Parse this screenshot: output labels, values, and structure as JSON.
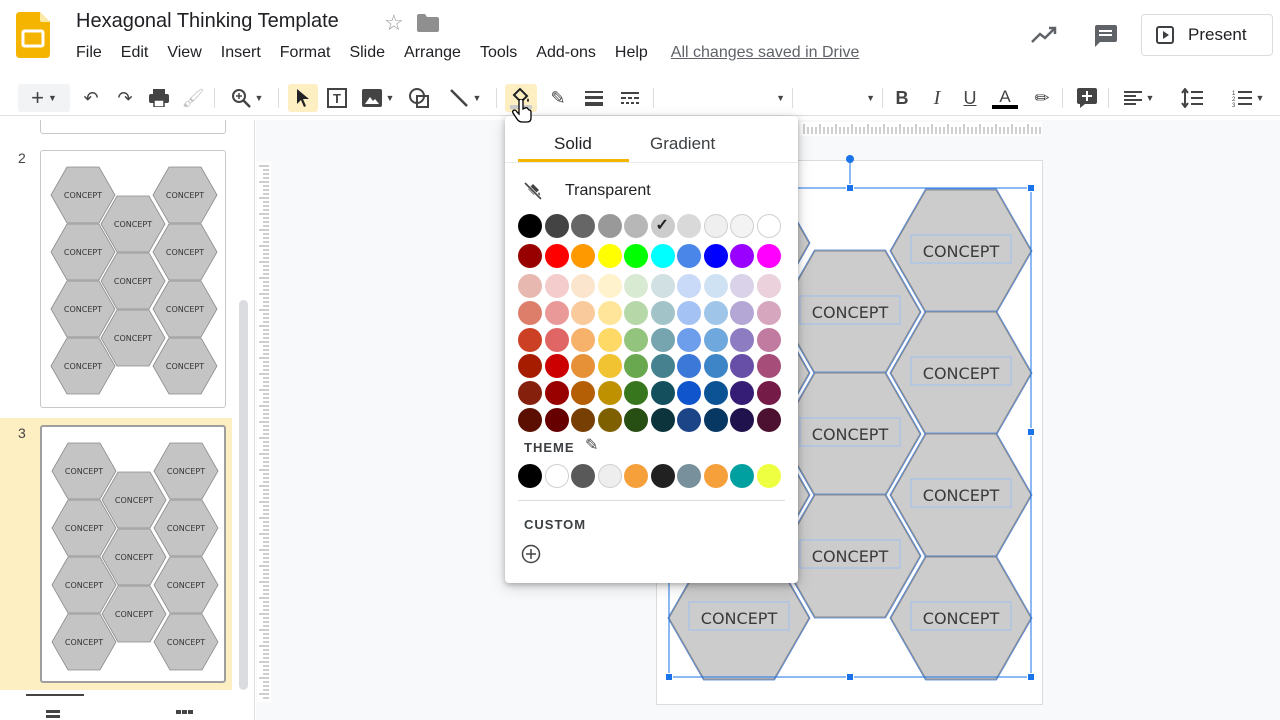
{
  "app": {
    "title": "Hexagonal Thinking Template",
    "saved_status": "All changes saved in Drive",
    "present_label": "Present"
  },
  "menu": [
    "File",
    "Edit",
    "View",
    "Insert",
    "Format",
    "Slide",
    "Arrange",
    "Tools",
    "Add-ons",
    "Help"
  ],
  "filmstrip": {
    "slides": [
      {
        "number": "2"
      },
      {
        "number": "3",
        "selected": true
      }
    ]
  },
  "slide": {
    "hex_label": "CONCEPT",
    "thumb_label": "CONCEPT"
  },
  "color_picker": {
    "tabs": [
      "Solid",
      "Gradient"
    ],
    "active_tab": "Solid",
    "transparent_label": "Transparent",
    "theme_label": "THEME",
    "custom_label": "CUSTOM",
    "grays": [
      "#000000",
      "#434343",
      "#666666",
      "#999999",
      "#b7b7b7",
      "#cccccc",
      "#d9d9d9",
      "#efefef",
      "#f3f3f3",
      "#ffffff"
    ],
    "selected_gray": "#cccccc",
    "bright": [
      "#980000",
      "#ff0000",
      "#ff9900",
      "#ffff00",
      "#00ff00",
      "#00ffff",
      "#4a86e8",
      "#0000ff",
      "#9900ff",
      "#ff00ff"
    ],
    "shades": [
      [
        "#e6b8af",
        "#f4cccc",
        "#fce5cd",
        "#fff2cc",
        "#d9ead3",
        "#d0e0e3",
        "#c9daf8",
        "#cfe2f3",
        "#d9d2e9",
        "#ead1dc"
      ],
      [
        "#dd7e6b",
        "#ea9999",
        "#f9cb9c",
        "#ffe599",
        "#b6d7a8",
        "#a2c4c9",
        "#a4c2f4",
        "#9fc5e8",
        "#b4a7d6",
        "#d5a6bd"
      ],
      [
        "#cc4125",
        "#e06666",
        "#f6b26b",
        "#ffd966",
        "#93c47d",
        "#76a5af",
        "#6d9eeb",
        "#6fa8dc",
        "#8e7cc3",
        "#c27ba0"
      ],
      [
        "#a61c00",
        "#cc0000",
        "#e69138",
        "#f1c232",
        "#6aa84f",
        "#45818e",
        "#3c78d8",
        "#3d85c6",
        "#674ea7",
        "#a64d79"
      ],
      [
        "#85200c",
        "#990000",
        "#b45f06",
        "#bf9000",
        "#38761d",
        "#134f5c",
        "#1155cc",
        "#0b5394",
        "#351c75",
        "#741b47"
      ],
      [
        "#5b0f00",
        "#660000",
        "#783f04",
        "#7f6000",
        "#274e13",
        "#0c343d",
        "#1c4587",
        "#073763",
        "#20124d",
        "#4c1130"
      ]
    ],
    "theme": [
      "#000000",
      "#ffffff",
      "#595959",
      "#eeeeee",
      "#f6a03c",
      "#212121",
      "#78909c",
      "#f6a03c",
      "#00a0a0",
      "#eeff41"
    ]
  }
}
